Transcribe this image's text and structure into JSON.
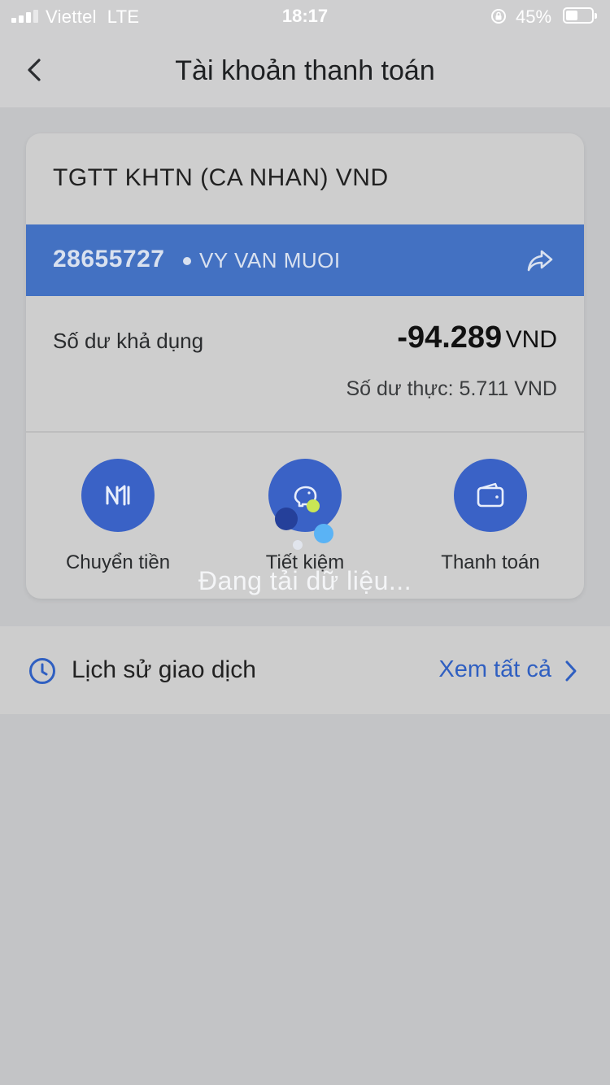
{
  "status_bar": {
    "carrier": "Viettel",
    "network": "LTE",
    "time": "18:17",
    "battery_percent": "45%",
    "battery_level": 0.45,
    "icons": [
      "signal-icon",
      "rotation-lock-icon",
      "battery-icon"
    ]
  },
  "header": {
    "title": "Tài khoản thanh toán",
    "back_icon": "chevron-left-icon"
  },
  "account": {
    "name": "TGTT KHTN (CA NHAN) VND",
    "number": "28655727",
    "holder": "VY VAN MUOI",
    "share_icon": "share-arrow-icon",
    "available_label": "Số dư khả dụng",
    "available_amount": "-94.289",
    "available_currency": "VND",
    "actual_balance": "Số dư thực: 5.711 VND"
  },
  "actions": [
    {
      "label": "Chuyển tiền",
      "icon": "transfer-icon"
    },
    {
      "label": "Tiết kiệm",
      "icon": "piggy-bank-icon"
    },
    {
      "label": "Thanh toán",
      "icon": "wallet-icon"
    }
  ],
  "loading": {
    "text": "Đang tải dữ liệu..."
  },
  "history": {
    "title": "Lịch sử giao dịch",
    "view_all": "Xem tất cả",
    "icon": "clock-icon"
  },
  "colors": {
    "accent_blue": "#4371c2",
    "action_blue": "#3a62c6",
    "link_blue": "#2f5fc1",
    "background": "#c3c4c6"
  }
}
